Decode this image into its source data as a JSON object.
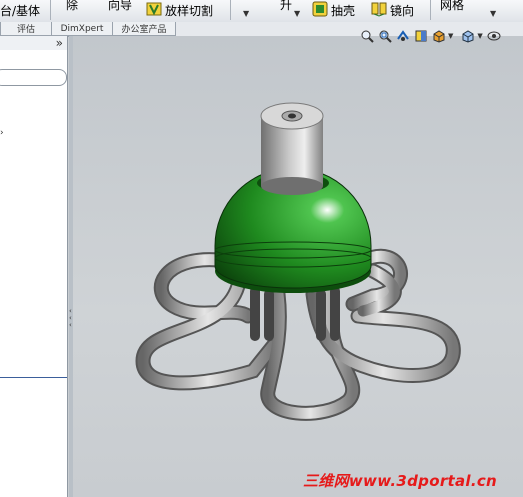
{
  "toolbar": {
    "boss_base_label": "台/基体",
    "truncated_label_1": "除",
    "truncated_label_2": "向导",
    "lofted_cut_label": "放样切割",
    "truncated_label_3": "升",
    "shell_label": "抽壳",
    "mirror_label": "镜向",
    "truncated_label_4": "网格"
  },
  "tabs": [
    {
      "label": "评估"
    },
    {
      "label": "DimXpert"
    },
    {
      "label": "办公室产品"
    }
  ],
  "left_panel": {
    "collapse_glyph": "»",
    "tree_arrow_glyph": "›"
  },
  "view_toolbar": {
    "icons": [
      "zoom-to-fit-icon",
      "zoom-to-area-icon",
      "previous-view-icon",
      "section-view-icon",
      "display-style-icon",
      "view-orientation-icon",
      "hide-show-icon"
    ]
  },
  "model": {
    "body_color": "#1f8a1f",
    "cap_color": "#9a9a9a",
    "tube_color": "#a8a8a8"
  },
  "watermark": {
    "text": "三维网www.3dportal.cn",
    "color": "#e61a1a"
  }
}
